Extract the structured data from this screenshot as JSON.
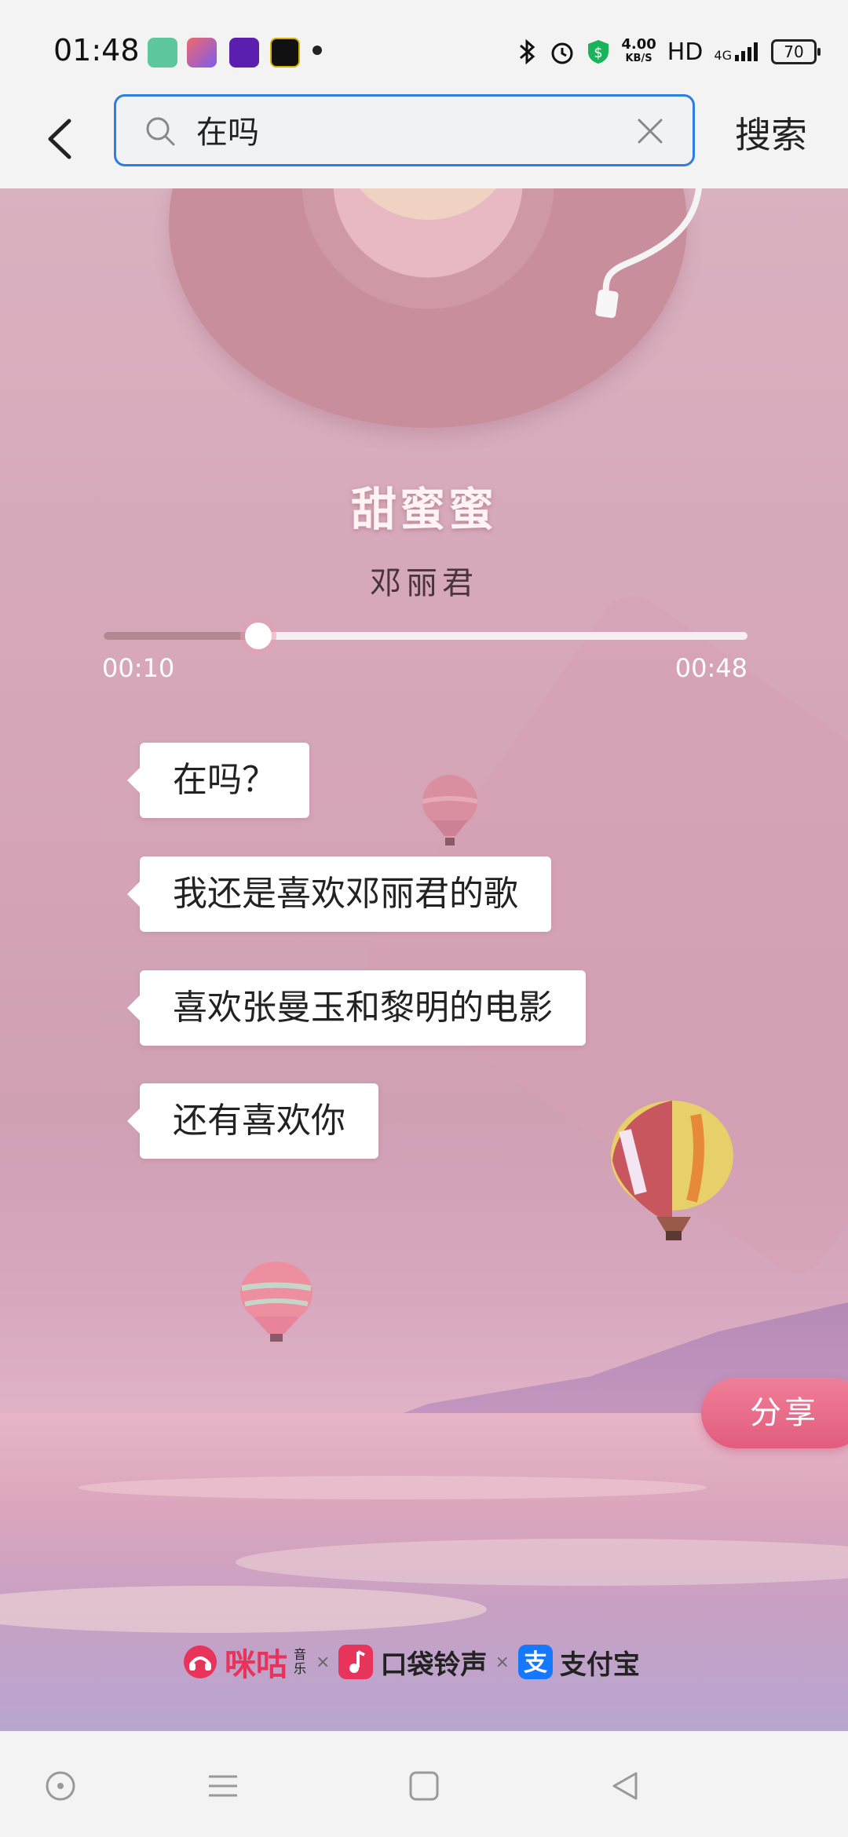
{
  "status_bar": {
    "time": "01:48",
    "network_speed_value": "4.00",
    "network_speed_unit": "KB/S",
    "hd_label": "HD",
    "signal_label": "4G",
    "battery_level": "70"
  },
  "search": {
    "query": "在吗",
    "search_button_label": "搜索"
  },
  "player": {
    "song_title": "甜蜜蜜",
    "artist": "邓丽君",
    "current_time": "00:10",
    "total_time": "00:48",
    "progress_fraction": 0.24
  },
  "messages": [
    "在吗？",
    "我还是喜欢邓丽君的歌",
    "喜欢张曼玉和黎明的电影",
    "还有喜欢你"
  ],
  "share_label": "分享",
  "brands": {
    "migu": "咪咕",
    "migu_suffix": "音乐",
    "separator": "×",
    "koudai": "口袋铃声",
    "alipay": "支付宝"
  },
  "colors": {
    "accent_blue": "#2e7de1",
    "share_pink": "#e25c7d",
    "migu_red": "#e8335a",
    "alipay_blue": "#1677ff"
  }
}
